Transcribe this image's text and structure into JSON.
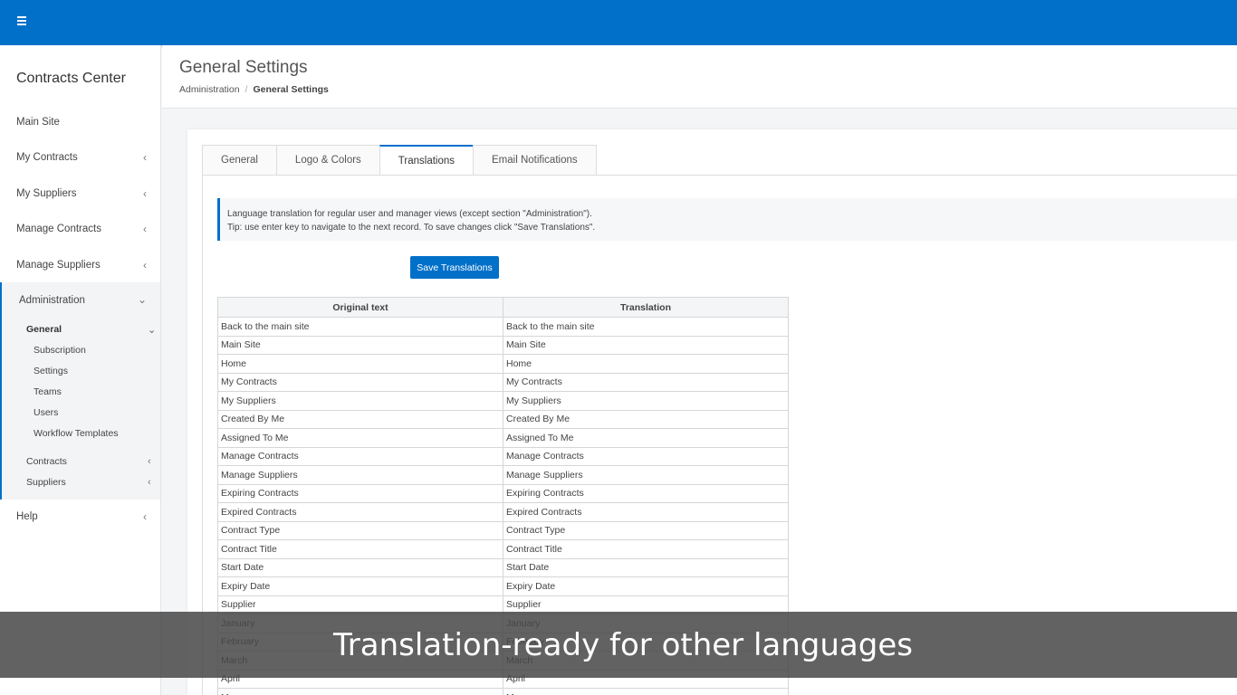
{
  "sidebar": {
    "brand": "Contracts Center",
    "items": [
      {
        "label": "Main Site",
        "chevron": ""
      },
      {
        "label": "My Contracts",
        "chevron": "‹"
      },
      {
        "label": "My Suppliers",
        "chevron": "‹"
      },
      {
        "label": "Manage Contracts",
        "chevron": "‹"
      },
      {
        "label": "Manage Suppliers",
        "chevron": "‹"
      }
    ],
    "administration": {
      "label": "Administration",
      "chevron": "⌄",
      "general": {
        "label": "General",
        "chevron": "⌄"
      },
      "general_children": [
        "Subscription",
        "Settings",
        "Teams",
        "Users",
        "Workflow Templates"
      ],
      "contracts": {
        "label": "Contracts",
        "chevron": "‹"
      },
      "suppliers": {
        "label": "Suppliers",
        "chevron": "‹"
      }
    },
    "help": {
      "label": "Help",
      "chevron": "‹"
    }
  },
  "header": {
    "title": "General Settings",
    "breadcrumb": {
      "root": "Administration",
      "separator": "/",
      "current": "General Settings"
    }
  },
  "tabs": [
    "General",
    "Logo & Colors",
    "Translations",
    "Email Notifications"
  ],
  "callout": {
    "line1": "Language translation for regular user and manager views (except section \"Administration\").",
    "line2": "Tip: use enter key to navigate to the next record. To save changes click \"Save Translations\"."
  },
  "save_label": "Save Translations",
  "table": {
    "headers": [
      "Original text",
      "Translation"
    ],
    "rows": [
      [
        "Back to the main site",
        "Back to the main site"
      ],
      [
        "Main Site",
        "Main Site"
      ],
      [
        "Home",
        "Home"
      ],
      [
        "My Contracts",
        "My Contracts"
      ],
      [
        "My Suppliers",
        "My Suppliers"
      ],
      [
        "Created By Me",
        "Created By Me"
      ],
      [
        "Assigned To Me",
        "Assigned To Me"
      ],
      [
        "Manage Contracts",
        "Manage Contracts"
      ],
      [
        "Manage Suppliers",
        "Manage Suppliers"
      ],
      [
        "Expiring Contracts",
        "Expiring Contracts"
      ],
      [
        "Expired Contracts",
        "Expired Contracts"
      ],
      [
        "Contract Type",
        "Contract Type"
      ],
      [
        "Contract Title",
        "Contract Title"
      ],
      [
        "Start Date",
        "Start Date"
      ],
      [
        "Expiry Date",
        "Expiry Date"
      ],
      [
        "Supplier",
        "Supplier"
      ],
      [
        "January",
        "January"
      ],
      [
        "February",
        "February"
      ],
      [
        "March",
        "March"
      ],
      [
        "April",
        "April"
      ],
      [
        "May",
        "May"
      ]
    ]
  },
  "overlay_caption": "Translation-ready for other languages"
}
